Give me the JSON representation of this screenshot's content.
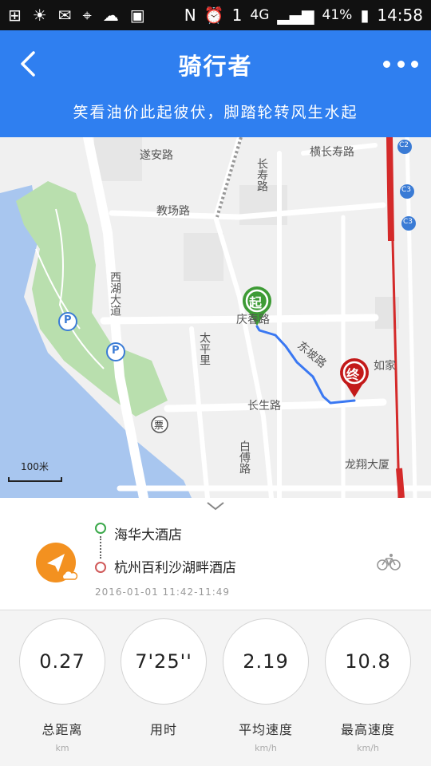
{
  "status_bar": {
    "signal_label": "4G",
    "battery": "41%",
    "time": "14:58",
    "sim_number": "1",
    "icons": [
      "plus-icon",
      "sun-icon",
      "mail-icon",
      "location-icon",
      "wechat-icon",
      "image-icon",
      "nfc-icon",
      "alarm-icon",
      "sim-icon",
      "signal-icon",
      "battery-icon"
    ]
  },
  "header": {
    "title": "骑行者",
    "slogan": "笑看油价此起彼伏，脚踏轮转风生水起",
    "accent_color": "#2f7ff0"
  },
  "map": {
    "roads": [
      "遂安路",
      "教场路",
      "庆春路",
      "长生路",
      "横长寿路",
      "长寿路",
      "东坡路",
      "西湖大道",
      "太平里",
      "白傅路",
      "龙翔大厦",
      "如家"
    ],
    "west_lake_label": "西湖",
    "ticket_label": "票",
    "parking_label": "P",
    "start_marker": "起",
    "end_marker": "终",
    "metro_labels": [
      "C2",
      "C3",
      "C3"
    ],
    "scale": "100米"
  },
  "route": {
    "start": "海华大酒店",
    "end": "杭州百利沙湖畔酒店",
    "time_range": "2016-01-01  11:42-11:49"
  },
  "stats": [
    {
      "value": "0.27",
      "label": "总距离",
      "unit": "km"
    },
    {
      "value": "7'25''",
      "label": "用时",
      "unit": ""
    },
    {
      "value": "2.19",
      "label": "平均速度",
      "unit": "km/h"
    },
    {
      "value": "10.8",
      "label": "最高速度",
      "unit": "km/h"
    }
  ]
}
